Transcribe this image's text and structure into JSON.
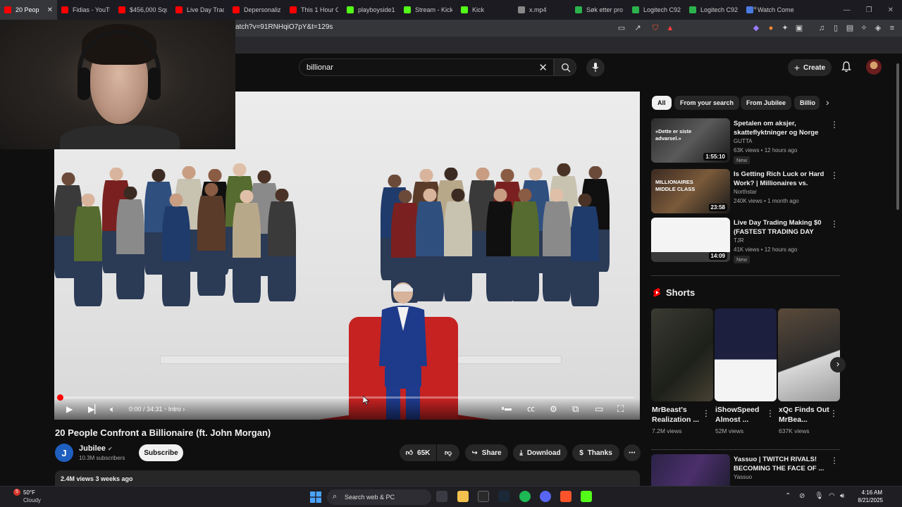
{
  "browser": {
    "tabs": [
      {
        "label": "20 Peop",
        "color": "#ff0000",
        "active": true
      },
      {
        "label": "Fidias - YouTu",
        "color": "#ff0000"
      },
      {
        "label": "$456,000 Squ",
        "color": "#ff0000"
      },
      {
        "label": "Live Day Trad",
        "color": "#ff0000"
      },
      {
        "label": "Depersonaliz",
        "color": "#ff0000"
      },
      {
        "label": "This 1 Hour G",
        "color": "#ff0000"
      },
      {
        "label": "playboyside1",
        "color": "#53fc18"
      },
      {
        "label": "Stream - Kick",
        "color": "#53fc18"
      },
      {
        "label": "Kick",
        "color": "#53fc18"
      },
      {
        "label": "x.mp4",
        "color": "#888888"
      },
      {
        "label": "Søk etter pro",
        "color": "#2bb24c"
      },
      {
        "label": "Logitech C92",
        "color": "#2bb24c"
      },
      {
        "label": "Logitech C92",
        "color": "#2bb24c"
      },
      {
        "label": "Watch Come",
        "color": "#4a7be0"
      }
    ],
    "url": "atch?v=91RNHqiO7pY&t=129s"
  },
  "youtube": {
    "search_value": "billionar",
    "create_label": "Create"
  },
  "player": {
    "timecode": "0:00 / 34:31",
    "chapter": "Intro"
  },
  "video": {
    "title": "20 People Confront a Billionaire (ft. John Morgan)",
    "channel_initial": "J",
    "channel_name": "Jubilee",
    "subscribers": "10.3M subscribers",
    "subscribe_label": "Subscribe",
    "likes": "65K",
    "share_label": "Share",
    "download_label": "Download",
    "thanks_label": "Thanks",
    "views_meta": "2.4M views  3 weeks ago"
  },
  "sidebar": {
    "chips": [
      "All",
      "From your search",
      "From Jubilee",
      "Billio"
    ],
    "recommendations": [
      {
        "title": "Spetalen om aksjer, skatteflyktninger og Norge ett...",
        "channel": "GUTTA",
        "meta": "63K views • 12 hours ago",
        "badge": "New",
        "duration": "1:55:10",
        "thumb_text": "«Dette er siste advarsel.»"
      },
      {
        "title": "Is Getting Rich Luck or Hard Work? | Millionaires vs. Middle...",
        "channel": "Northstar",
        "meta": "240K views • 1 month ago",
        "badge": "",
        "duration": "23:58",
        "thumb_text": "MILLIONAIRES MIDDLE CLASS"
      },
      {
        "title": "Live Day Trading Making $0 (FASTEST TRADING DAY EVER)",
        "channel": "TJR",
        "meta": "41K views • 12 hours ago",
        "badge": "New",
        "duration": "14:09",
        "thumb_text": ""
      }
    ],
    "shorts_title": "Shorts",
    "shorts": [
      {
        "title": "MrBeast's Realization ...",
        "views": "7.2M views"
      },
      {
        "title": "iShowSpeed Almost ...",
        "views": "52M views"
      },
      {
        "title": "xQc Finds Out MrBea...",
        "views": "637K views"
      }
    ],
    "bottom_rec": {
      "title": "Yassuo | TWITCH RIVALS! BECOMING THE FACE OF ...",
      "channel": "Yassuo"
    }
  },
  "taskbar": {
    "weather_temp": "50°F",
    "weather_desc": "Cloudy",
    "weather_badge": "5",
    "search_placeholder": "Search web & PC",
    "time": "4:16 AM",
    "date": "8/21/2025"
  }
}
